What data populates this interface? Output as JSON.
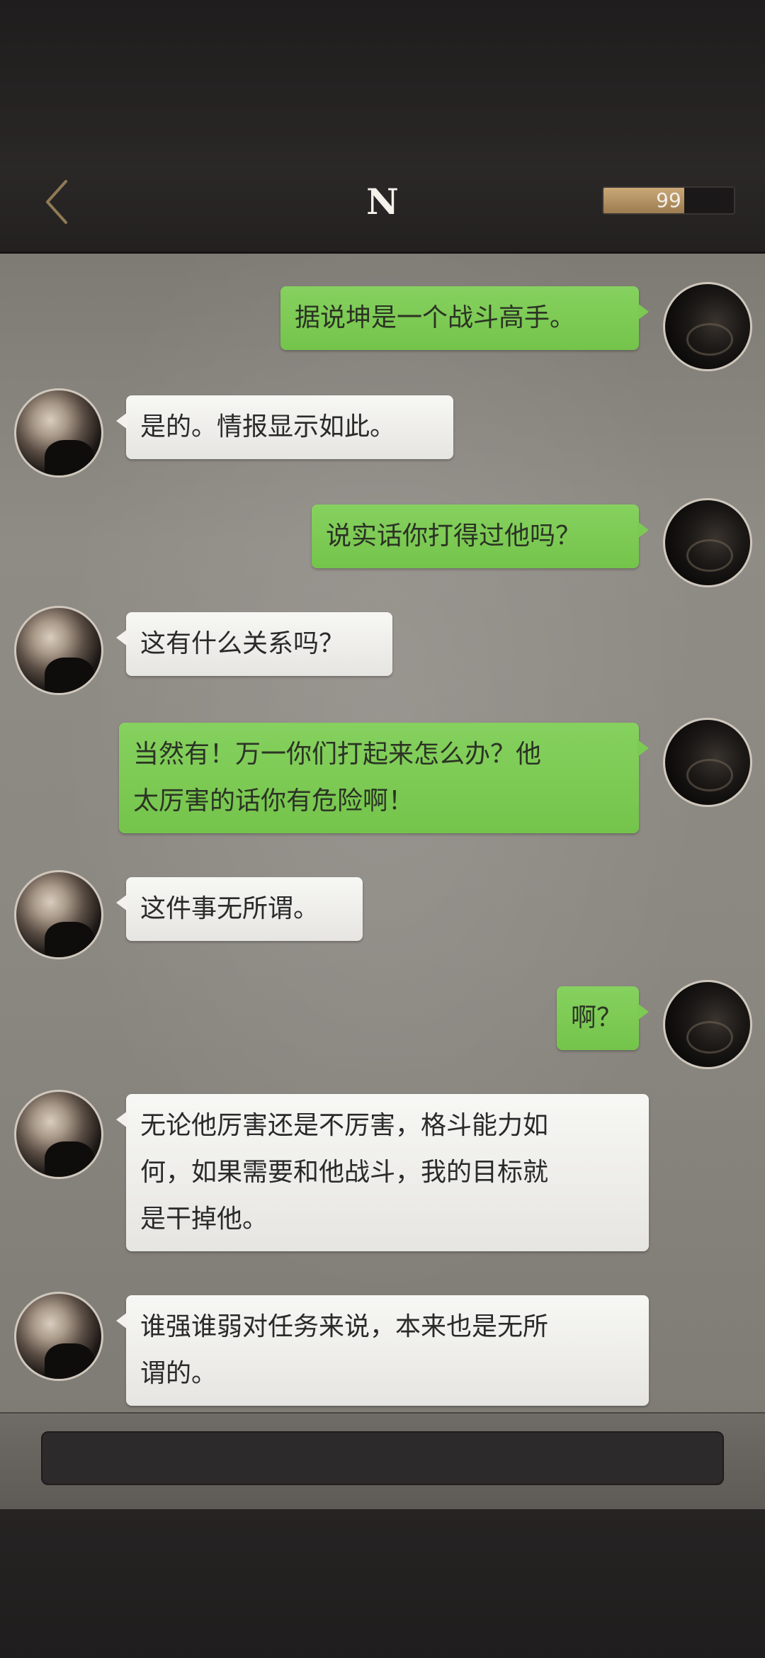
{
  "header": {
    "title": "N",
    "meter_value": "99",
    "meter_fill_fraction": 0.62,
    "colors": {
      "bar": "#252222",
      "meter_fill": "#b8966a"
    }
  },
  "icons": {
    "back": "chevron-left-icon"
  },
  "messages": [
    {
      "side": "me",
      "lines": [
        "据说坤是一个战斗高手。"
      ]
    },
    {
      "side": "other",
      "lines": [
        "是的。情报显示如此。"
      ]
    },
    {
      "side": "me",
      "lines": [
        "说实话你打得过他吗？"
      ]
    },
    {
      "side": "other",
      "lines": [
        "这有什么关系吗？"
      ]
    },
    {
      "side": "me",
      "lines": [
        "当然有！万一你们打起来怎么办？他",
        "太厉害的话你有危险啊！"
      ]
    },
    {
      "side": "other",
      "lines": [
        "这件事无所谓。"
      ]
    },
    {
      "side": "me",
      "lines": [
        "啊？"
      ]
    },
    {
      "side": "other",
      "lines": [
        "无论他厉害还是不厉害，格斗能力如",
        "何，如果需要和他战斗，我的目标就",
        "是干掉他。"
      ]
    },
    {
      "side": "other",
      "lines": [
        "谁强谁弱对任务来说，本来也是无所",
        "谓的。"
      ]
    }
  ],
  "input": {
    "value": "",
    "placeholder": ""
  },
  "colors": {
    "bubble_me": "#7cca53",
    "bubble_other": "#f2f1ee",
    "chat_background": "#8a8680"
  }
}
